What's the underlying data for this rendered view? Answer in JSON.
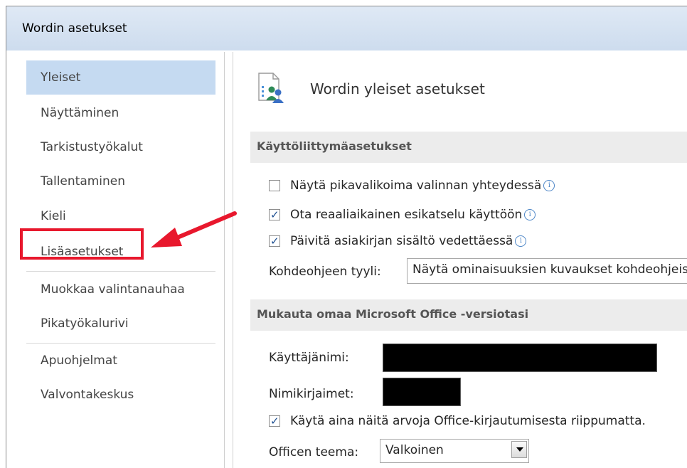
{
  "window": {
    "title": "Wordin asetukset"
  },
  "sidebar": {
    "items": [
      {
        "label": "Yleiset",
        "active": true
      },
      {
        "label": "Näyttäminen"
      },
      {
        "label": "Tarkistustyökalut"
      },
      {
        "label": "Tallentaminen"
      },
      {
        "label": "Kieli"
      },
      {
        "label": "Lisäasetukset",
        "highlighted": true
      },
      {
        "label": "Muokkaa valintanauhaa"
      },
      {
        "label": "Pikatyökalurivi"
      },
      {
        "label": "Apuohjelmat"
      },
      {
        "label": "Valvontakeskus"
      }
    ]
  },
  "main": {
    "title": "Wordin yleiset asetukset",
    "ui_section": {
      "heading": "Käyttöliittymäasetukset",
      "options": [
        {
          "label": "Näytä pikavalikoima valinnan yhteydessä",
          "checked": false
        },
        {
          "label": "Ota reaaliaikainen esikatselu käyttöön",
          "checked": true
        },
        {
          "label": "Päivitä asiakirjan sisältö vedettäessä",
          "checked": true
        }
      ],
      "tooltip_style": {
        "label": "Kohdeohjeen tyyli:",
        "value": "Näytä ominaisuuksien kuvaukset kohdeohjeissa"
      }
    },
    "personalize_section": {
      "heading": "Mukauta omaa Microsoft Office -versiotasi",
      "username_label": "Käyttäjänimi:",
      "initials_label": "Nimikirjaimet:",
      "always_use": {
        "label": "Käytä aina näitä arvoja Office-kirjautumisesta riippumatta.",
        "checked": true
      },
      "theme": {
        "label": "Officen teema:",
        "value": "Valkoinen"
      }
    }
  },
  "colors": {
    "active_item": "#c5daf1",
    "highlight": "#e8182d",
    "titlebar": "#d6e3f2",
    "section_bg": "#ececec"
  },
  "check_glyph": "✓",
  "info_glyph": "i"
}
